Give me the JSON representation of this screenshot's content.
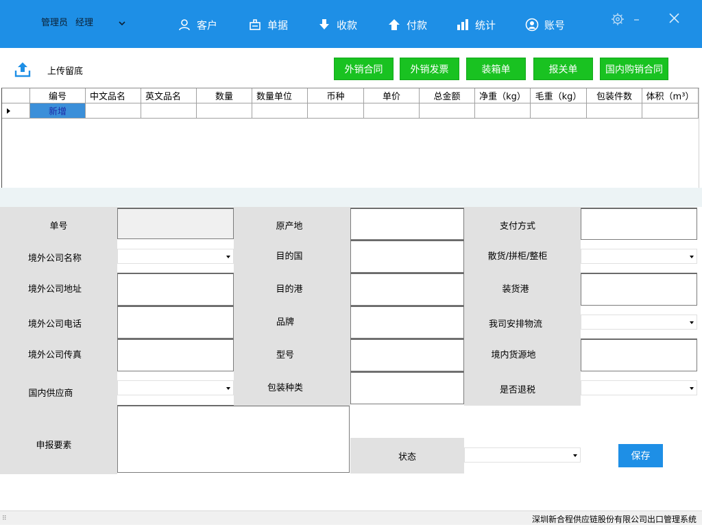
{
  "header": {
    "user_role": "管理员",
    "user_name": "经理",
    "nav": [
      {
        "label": "客户",
        "icon": "person-icon"
      },
      {
        "label": "单据",
        "icon": "document-stamp-icon"
      },
      {
        "label": "收款",
        "icon": "download-arrow-icon"
      },
      {
        "label": "付款",
        "icon": "upload-arrow-icon"
      },
      {
        "label": "统计",
        "icon": "bar-chart-icon"
      },
      {
        "label": "账号",
        "icon": "account-circle-icon"
      }
    ],
    "colors": {
      "bar": "#1e8fe6"
    }
  },
  "toolbar": {
    "upload_label": "上传留底",
    "buttons": [
      "外销合同",
      "外销发票",
      "装箱单",
      "报关单",
      "国内购销合同"
    ],
    "button_color": "#19c221"
  },
  "grid": {
    "columns": [
      "编号",
      "中文品名",
      "英文品名",
      "数量",
      "数量单位",
      "币种",
      "单价",
      "总金额",
      "净重（kg）",
      "毛重（kg）",
      "包装件数",
      "体积（m³）"
    ],
    "rows": [
      [
        "新增",
        "",
        "",
        "",
        "",
        "",
        "",
        "",
        "",
        "",
        "",
        ""
      ]
    ]
  },
  "form": {
    "labels": {
      "order_no": "单号",
      "overseas_name": "境外公司名称",
      "overseas_address": "境外公司地址",
      "overseas_phone": "境外公司电话",
      "overseas_fax": "境外公司传真",
      "domestic_supplier": "国内供应商",
      "declaration_elements": "申报要素",
      "origin": "原产地",
      "dest_country": "目的国",
      "dest_port": "目的港",
      "brand": "品牌",
      "model": "型号",
      "package_type": "包装种类",
      "payment_method": "支付方式",
      "container_type": "散货/拼柜/整柜",
      "loading_port": "装货港",
      "our_logistics": "我司安排物流",
      "domestic_source": "境内货源地",
      "tax_refund": "是否退税",
      "status": "状态"
    },
    "save_label": "保存"
  },
  "statusbar": {
    "text": "深圳新合程供应链股份有限公司出口管理系统"
  }
}
